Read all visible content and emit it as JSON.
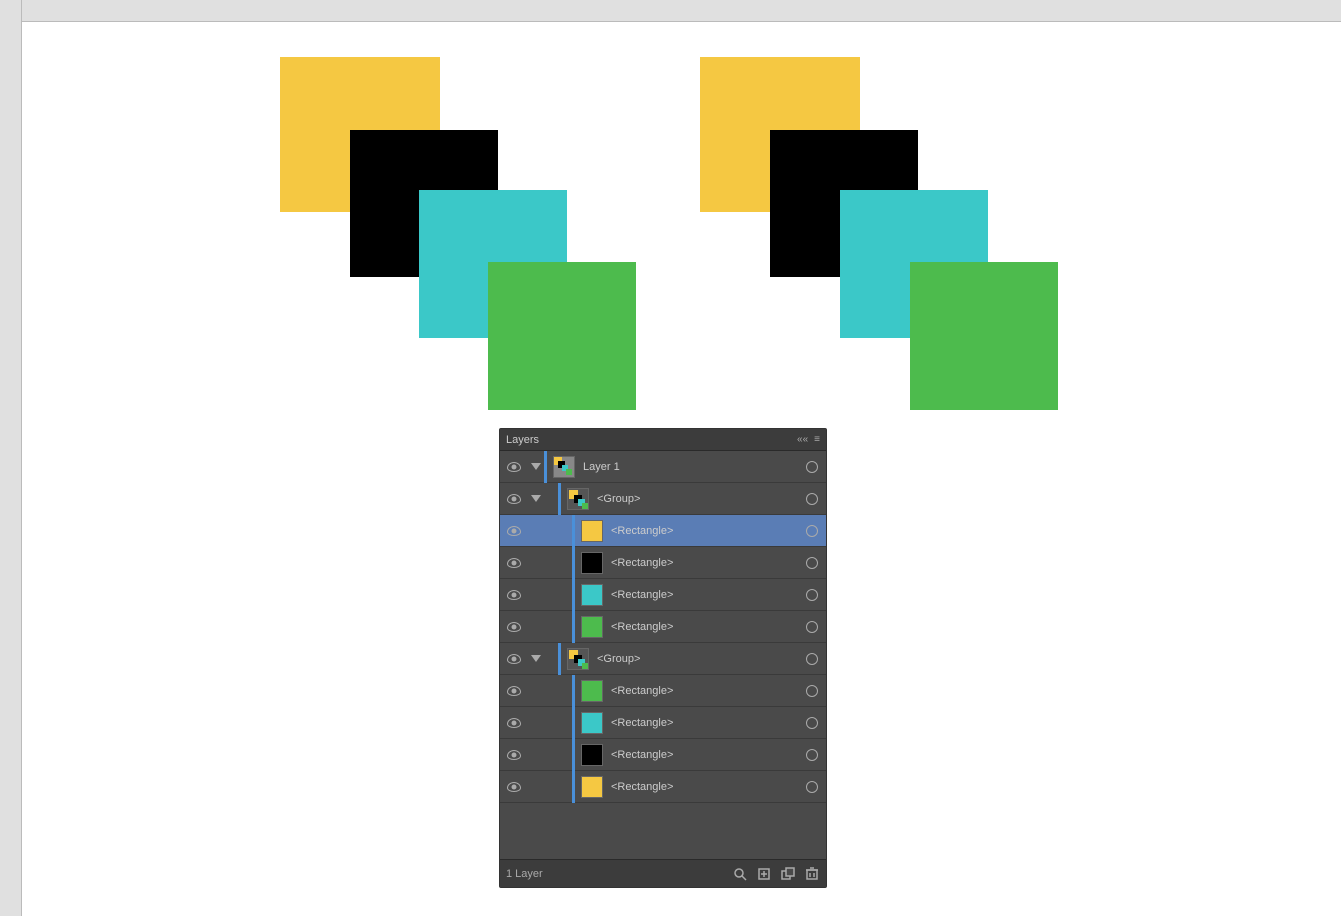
{
  "panel": {
    "title": "Layers",
    "collapse_label": "««",
    "menu_label": "≡",
    "close_label": "×",
    "footer_layer_count": "1 Layer"
  },
  "layers": [
    {
      "id": "layer1",
      "name": "Layer 1",
      "type": "layer",
      "indent": 0,
      "expanded": true,
      "selected": false,
      "thumb": "layer1"
    },
    {
      "id": "group1",
      "name": "<Group>",
      "type": "group",
      "indent": 1,
      "expanded": true,
      "selected": false,
      "thumb": "group"
    },
    {
      "id": "rect1",
      "name": "<Rectangle>",
      "type": "rectangle",
      "indent": 2,
      "selected": true,
      "thumb": "yellow"
    },
    {
      "id": "rect2",
      "name": "<Rectangle>",
      "type": "rectangle",
      "indent": 2,
      "selected": false,
      "thumb": "black"
    },
    {
      "id": "rect3",
      "name": "<Rectangle>",
      "type": "rectangle",
      "indent": 2,
      "selected": false,
      "thumb": "teal"
    },
    {
      "id": "rect4",
      "name": "<Rectangle>",
      "type": "rectangle",
      "indent": 2,
      "selected": false,
      "thumb": "green"
    },
    {
      "id": "group2",
      "name": "<Group>",
      "type": "group",
      "indent": 1,
      "expanded": true,
      "selected": false,
      "thumb": "group"
    },
    {
      "id": "rect5",
      "name": "<Rectangle>",
      "type": "rectangle",
      "indent": 2,
      "selected": false,
      "thumb": "green"
    },
    {
      "id": "rect6",
      "name": "<Rectangle>",
      "type": "rectangle",
      "indent": 2,
      "selected": false,
      "thumb": "teal"
    },
    {
      "id": "rect7",
      "name": "<Rectangle>",
      "type": "rectangle",
      "indent": 2,
      "selected": false,
      "thumb": "black"
    },
    {
      "id": "rect8",
      "name": "<Rectangle>",
      "type": "rectangle",
      "indent": 2,
      "selected": false,
      "thumb": "yellow"
    }
  ],
  "canvas": {
    "shapes": {
      "left_group": {
        "yellow": {
          "color": "#f5c842"
        },
        "black": {
          "color": "#000000"
        },
        "teal": {
          "color": "#3bc8c8"
        },
        "green": {
          "color": "#4dbb4d"
        }
      },
      "right_group": {
        "yellow": {
          "color": "#f5c842"
        },
        "black": {
          "color": "#000000"
        },
        "teal": {
          "color": "#3bc8c8"
        },
        "green": {
          "color": "#4dbb4d"
        }
      }
    }
  }
}
